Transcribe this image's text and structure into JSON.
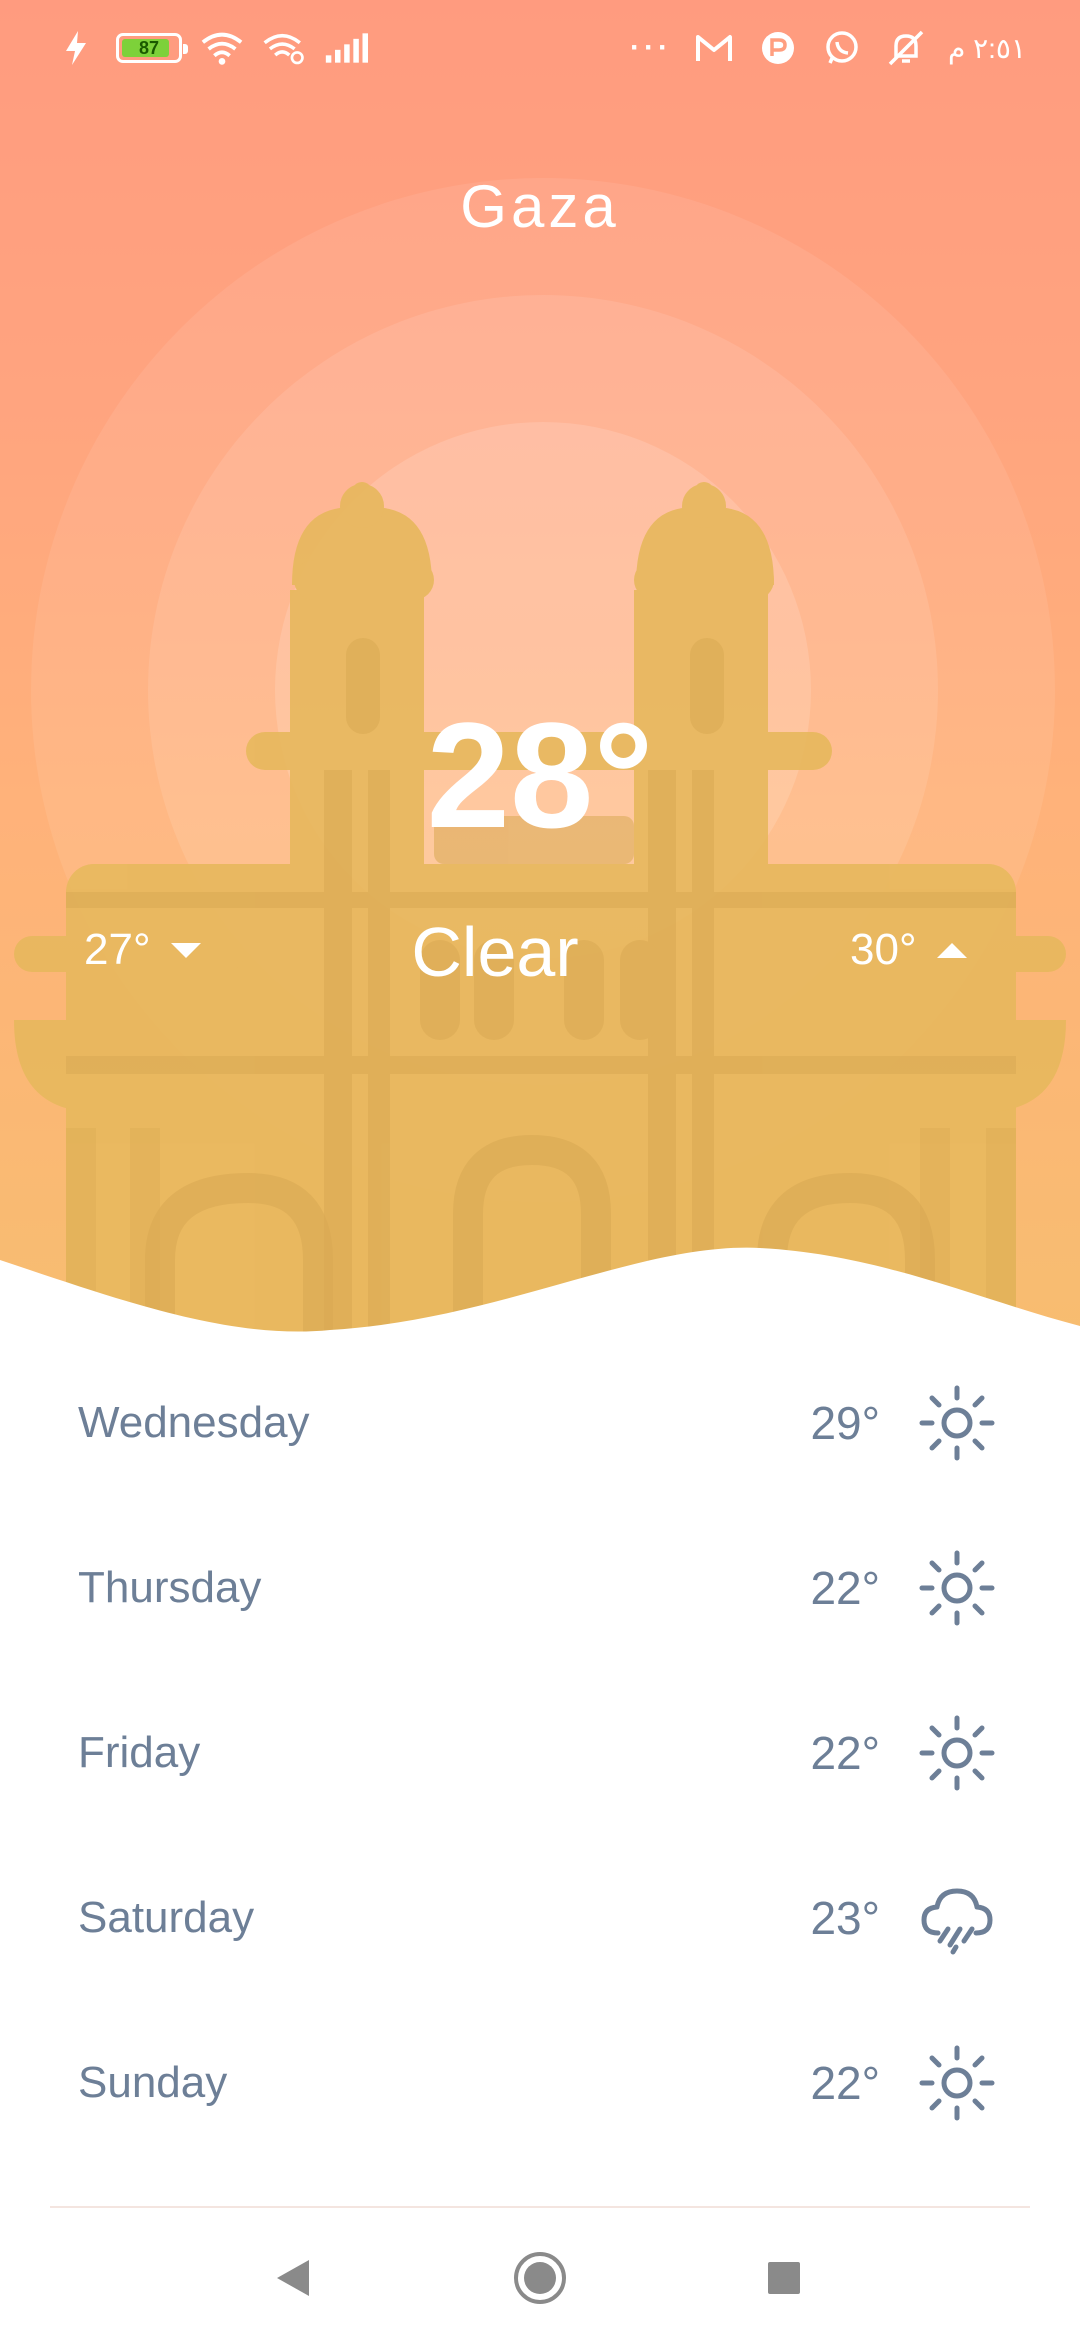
{
  "status_bar": {
    "battery_level": "87",
    "time": "٢:٥١ م",
    "overflow_dots": "···"
  },
  "weather": {
    "city": "Gaza",
    "current_temp": "28°",
    "condition": "Clear",
    "temp_min": "27°",
    "temp_max": "30°"
  },
  "forecast": [
    {
      "day": "Wednesday",
      "temp": "29°",
      "icon": "sun-icon"
    },
    {
      "day": "Thursday",
      "temp": "22°",
      "icon": "sun-icon"
    },
    {
      "day": "Friday",
      "temp": "22°",
      "icon": "sun-icon"
    },
    {
      "day": "Saturday",
      "temp": "23°",
      "icon": "cloud-rain-icon"
    },
    {
      "day": "Sunday",
      "temp": "22°",
      "icon": "sun-icon"
    }
  ],
  "nav_bar": {
    "back_icon": "triangle-back-icon",
    "home_icon": "circle-home-icon",
    "recents_icon": "square-recents-icon"
  },
  "colors": {
    "hero_top": "#ff9b7f",
    "hero_bottom": "#f7bd70",
    "landmark": "#e8b85e",
    "forecast_text": "#6d7f97",
    "battery_fill": "#7dd13a"
  }
}
